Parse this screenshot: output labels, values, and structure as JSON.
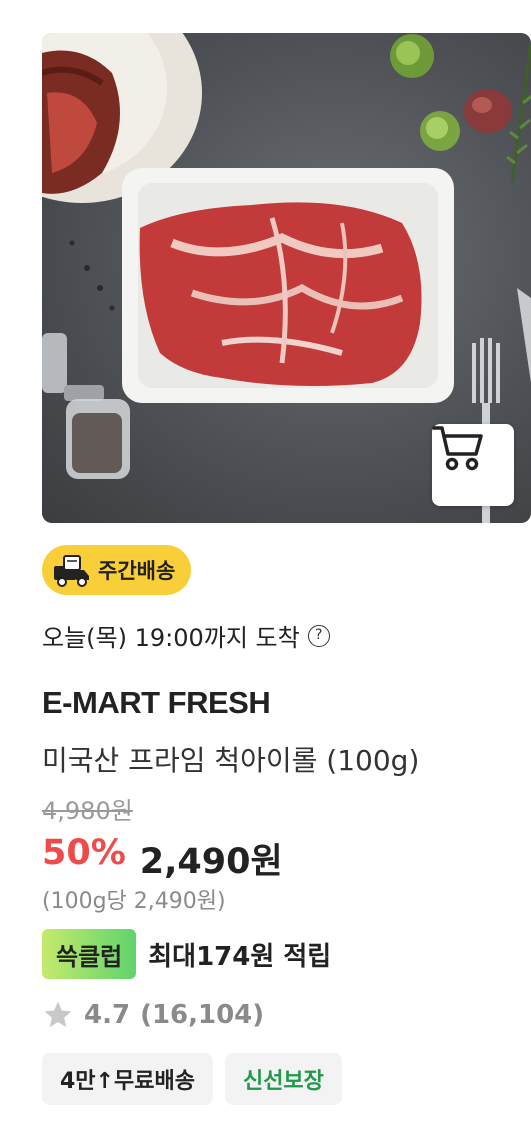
{
  "product": {
    "image_alt": "US Prime chuck eye roll steak",
    "cart_icon": "shopping-cart-icon",
    "delivery_badge": {
      "label": "주간배송",
      "icon": "delivery-truck-icon",
      "color": "#f9cf39"
    },
    "arrival_text": "오늘(목) 19:00까지 도착",
    "help_icon": "?",
    "brand": "E-MART FRESH",
    "name": "미국산 프라임 척아이롤 (100g)",
    "original_price": "4,980원",
    "discount": "50%",
    "sale_price": "2,490원",
    "unit_price": "(100g당 2,490원)",
    "club": {
      "badge": "쓱클럽",
      "text": "최대174원 적립"
    },
    "rating": {
      "icon": "star-icon",
      "value": "4.7",
      "count": "(16,104)"
    },
    "tags": [
      {
        "label": "4만↑무료배송"
      },
      {
        "label": "신선보장"
      }
    ],
    "colors": {
      "discount": "#ef4b4b",
      "fresh_tag": "#1f9a4b",
      "club_start": "#c6ea6d",
      "club_end": "#5fd36d"
    }
  }
}
